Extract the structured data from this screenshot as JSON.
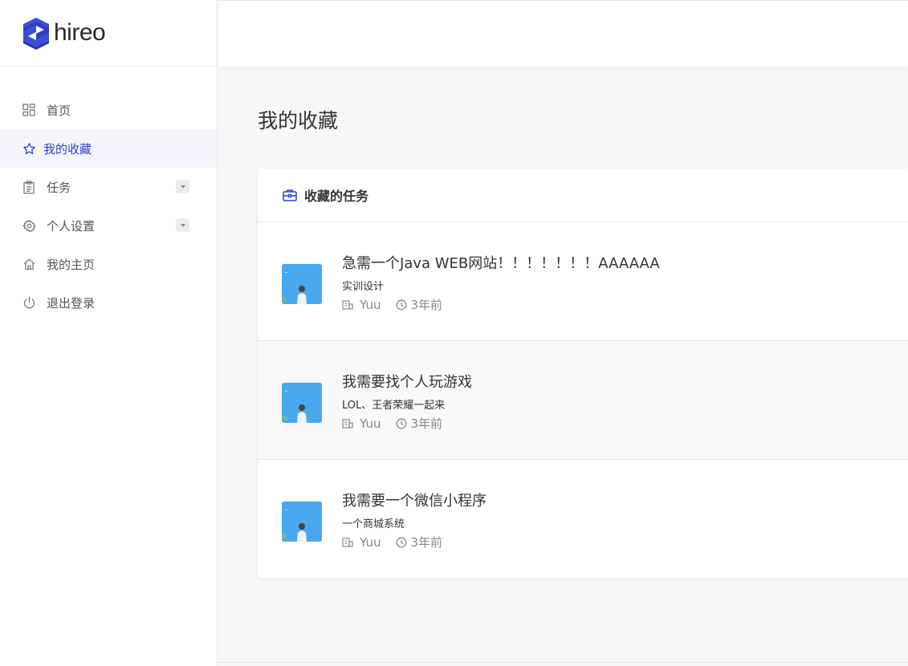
{
  "brand": {
    "name": "hireo",
    "accent": "#2e3fc2"
  },
  "sidebar": {
    "items": [
      {
        "label": "首页",
        "icon": "dashboard-icon"
      },
      {
        "label": "我的收藏",
        "icon": "star-icon",
        "active": true
      },
      {
        "label": "任务",
        "icon": "clipboard-icon",
        "has_submenu": true
      },
      {
        "label": "个人设置",
        "icon": "gear-icon",
        "has_submenu": true
      },
      {
        "label": "我的主页",
        "icon": "home-icon"
      },
      {
        "label": "退出登录",
        "icon": "power-icon"
      }
    ]
  },
  "main": {
    "page_title": "我的收藏",
    "card_title": "收藏的任务",
    "tasks": [
      {
        "title": "急需一个Java WEB网站！！！！！！！AAAAAA",
        "category": "实训设计",
        "author": "Yuu",
        "time": "3年前"
      },
      {
        "title": "我需要找个人玩游戏",
        "category": "LOL、王者荣耀一起来",
        "author": "Yuu",
        "time": "3年前"
      },
      {
        "title": "我需要一个微信小程序",
        "category": "一个商城系统",
        "author": "Yuu",
        "time": "3年前"
      }
    ]
  }
}
